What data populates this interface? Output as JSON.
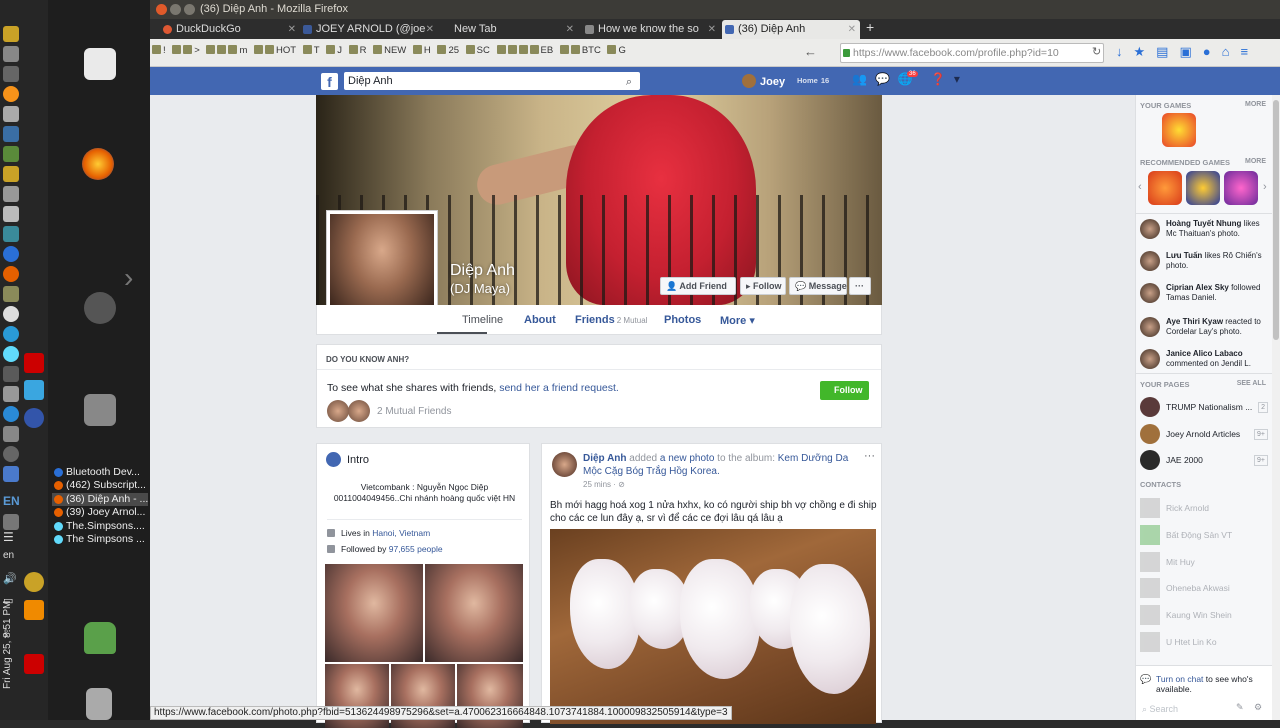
{
  "window": {
    "title": "(36) Diệp Anh - Mozilla Firefox"
  },
  "desktop": {
    "clock": "Fri Aug 25, 8:51 PM",
    "lang": "EN",
    "lang_lower": "en",
    "windows": [
      "Bluetooth Dev...",
      "(462) Subscript...",
      "(36) Diệp Anh - ...",
      "(39) Joey Arnol...",
      "The.Simpsons....",
      "The Simpsons ..."
    ]
  },
  "tabs": [
    {
      "label": "DuckDuckGo",
      "color": "#de5833"
    },
    {
      "label": "JOEY ARNOLD (@joe",
      "color": "#3b5998"
    },
    {
      "label": "New Tab",
      "color": "#2d2d2d"
    },
    {
      "label": "How we know the so",
      "color": "#888888"
    },
    {
      "label": "(36) Diệp Anh",
      "color": "#4267b2"
    }
  ],
  "bookmarks": [
    "!",
    ">",
    "m",
    "HOT",
    "T",
    "J",
    "R",
    "NEW",
    "H",
    "25",
    "SC",
    "EB",
    "BTC",
    "G"
  ],
  "url": "https://www.facebook.com/profile.php?id=10",
  "fb": {
    "search_value": "Diệp Anh",
    "user_name": "Joey",
    "home_label": "Home",
    "home_count": "16",
    "notif_count": "36",
    "logo": "f"
  },
  "profile": {
    "name": "Diệp Anh",
    "nickname": "(DJ Maya)",
    "buttons": {
      "add_friend": "Add Friend",
      "follow": "Follow",
      "message": "Message",
      "more": "···"
    },
    "tabs": {
      "timeline": "Timeline",
      "about": "About",
      "friends": "Friends",
      "friends_mutual": "2 Mutual",
      "photos": "Photos",
      "more": "More ▾"
    }
  },
  "dyk": {
    "heading": "DO YOU KNOW ANH?",
    "text": "To see what she shares with friends,",
    "link": "send her a friend request.",
    "follow": "Follow",
    "mutual": "2 Mutual Friends"
  },
  "intro": {
    "heading": "Intro",
    "bio_1": "Vietcombank : Nguyễn Ngọc Diệp",
    "bio_2": "0011004049456..Chi nhánh hoàng quốc việt HN",
    "lives_prefix": "Lives in",
    "lives_link": "Hanoi, Vietnam",
    "followed_prefix": "Followed by",
    "followed_link": "97,655 people"
  },
  "post": {
    "author": "Diệp Anh",
    "added": "added",
    "new_photo": "a new photo",
    "to_album": "to the album:",
    "album": "Kem Dưỡng Da Mộc Cặg Bóg Trắg Hồg Korea.",
    "time": "25 mins · ⊘",
    "more": "···",
    "text": "Bh mới hagg hoá xog 1 nửa hxhx, ko có người ship bh vợ chồng e đi ship cho các ce lun đây ạ, sr vì để các ce đợi lâu qá lâu ạ"
  },
  "right": {
    "your_games": "YOUR GAMES",
    "recommended": "RECOMMENDED GAMES",
    "more": "MORE",
    "ticker": [
      {
        "name": "Hoàng Tuyết Nhung",
        "rest": "likes Mc Thaituan's photo."
      },
      {
        "name": "Lưu Tuấn",
        "rest": "likes Rô Chiến's photo."
      },
      {
        "name": "Ciprian Alex Sky",
        "rest": "followed Tamas Daniel."
      },
      {
        "name": "Aye Thiri Kyaw",
        "rest": "reacted to Cordelar Lay's photo."
      },
      {
        "name": "Janice Alico Labaco",
        "rest": "commented on Jendil L."
      }
    ],
    "your_pages": "YOUR PAGES",
    "see_all": "SEE ALL",
    "pages": [
      {
        "name": "TRUMP Nationalism ...",
        "count": "2"
      },
      {
        "name": "Joey Arnold Articles",
        "count": "9+"
      },
      {
        "name": "JAE 2000",
        "count": "9+"
      }
    ],
    "contacts_heading": "CONTACTS",
    "contacts": [
      "Rick Arnold",
      "Bất Động Sản VT",
      "Mit Huy",
      "Oheneba Akwasi",
      "Kaung Win Shein",
      "U Htet Lin Ko"
    ],
    "chat_link": "Turn on chat",
    "chat_rest": "to see who's available.",
    "search": "Search"
  },
  "status_url": "https://www.facebook.com/photo.php?fbid=513624498975296&set=a.470062316664848.1073741884.100009832505914&type=3"
}
